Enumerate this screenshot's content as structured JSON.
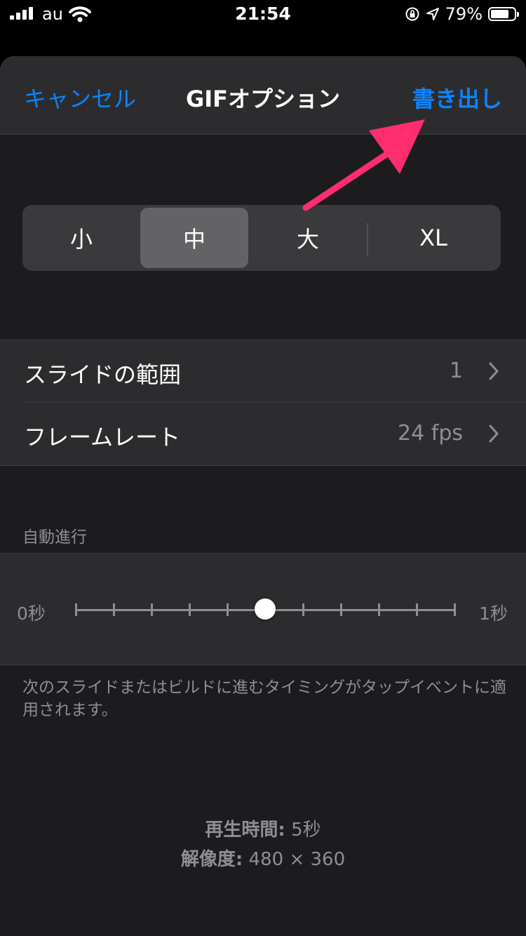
{
  "status_bar": {
    "carrier": "au",
    "time": "21:54",
    "battery_percent": "79%",
    "battery_level": 0.79,
    "icons": [
      "signal-icon",
      "wifi-icon",
      "rotation-lock-icon",
      "location-icon",
      "battery-icon"
    ]
  },
  "nav": {
    "cancel_label": "キャンセル",
    "title": "GIFオプション",
    "export_label": "書き出し"
  },
  "size_segment": {
    "options": [
      "小",
      "中",
      "大",
      "XL"
    ],
    "selected": "中"
  },
  "settings": {
    "slide_range": {
      "label": "スライドの範囲",
      "value": "1"
    },
    "frame_rate": {
      "label": "フレームレート",
      "value": "24 fps"
    }
  },
  "auto_advance": {
    "header": "自動進行",
    "min_label": "0秒",
    "max_label": "1秒",
    "value_fraction": 0.5,
    "footnote": "次のスライドまたはビルドに進むタイミングがタップイベントに適用されます。"
  },
  "summary": {
    "duration_label": "再生時間:",
    "duration_value": "5秒",
    "resolution_label": "解像度:",
    "resolution_value": "480 × 360"
  },
  "colors": {
    "accent": "#0a84ff",
    "annotation_arrow": "#ff2d6f",
    "background": "#1c1c1e",
    "cell": "#2c2c2e"
  }
}
